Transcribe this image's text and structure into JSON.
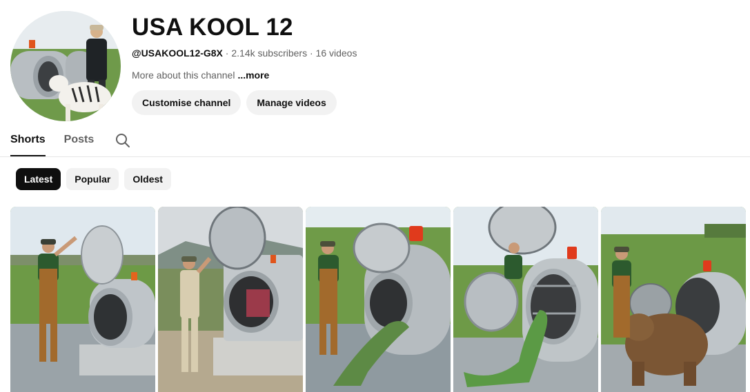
{
  "channel": {
    "name": "USA KOOL 12",
    "handle": "@USAKOOL12-G8X",
    "subscribers": "2.14k subscribers",
    "videos": "16 videos",
    "about": "More about this channel",
    "more_label": "...more",
    "separator": "·"
  },
  "actions": {
    "customise_label": "Customise channel",
    "manage_label": "Manage videos"
  },
  "tabs": [
    {
      "label": "Shorts",
      "active": true
    },
    {
      "label": "Posts",
      "active": false
    }
  ],
  "filters": [
    {
      "label": "Latest",
      "active": true
    },
    {
      "label": "Popular",
      "active": false
    },
    {
      "label": "Oldest",
      "active": false
    }
  ],
  "shorts": [
    {
      "subject": "worker-opening-steel-tank"
    },
    {
      "subject": "worker-with-meat-in-machine"
    },
    {
      "subject": "iguana-entering-tank"
    },
    {
      "subject": "iguana-by-open-drum"
    },
    {
      "subject": "bear-at-steel-tank"
    }
  ],
  "icons": {
    "search": "search-icon"
  }
}
